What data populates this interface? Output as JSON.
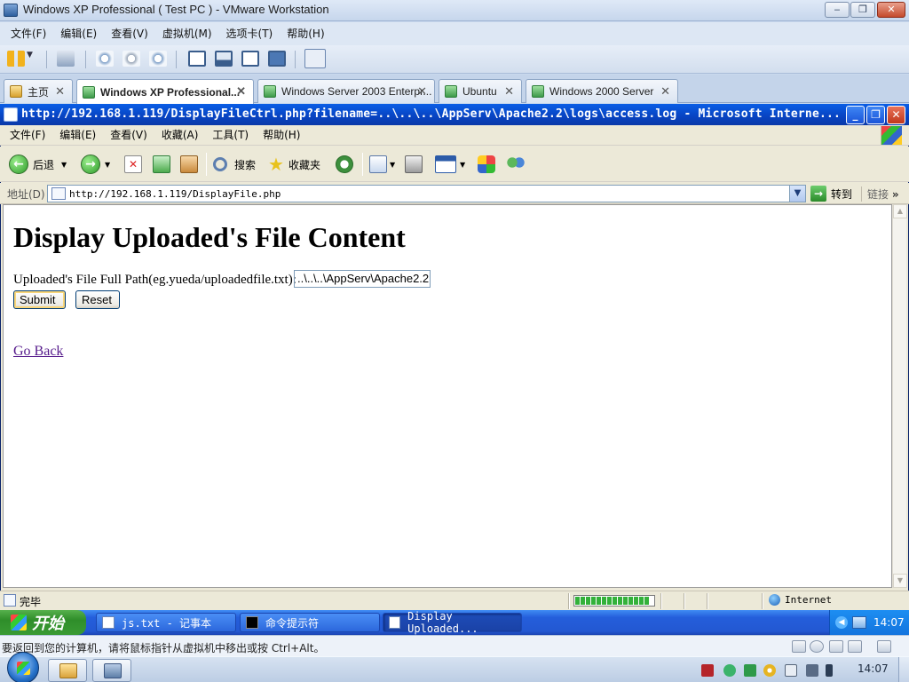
{
  "vmware": {
    "title": "Windows XP Professional ( Test PC ) - VMware Workstation",
    "caption_buttons": {
      "minimize": "‒",
      "maximize": "❐",
      "close": "✕"
    },
    "menu": [
      "文件(F)",
      "编辑(E)",
      "查看(V)",
      "虚拟机(M)",
      "选项卡(T)",
      "帮助(H)"
    ],
    "tabs": [
      {
        "label": "主页",
        "close": "✕"
      },
      {
        "label": "Windows XP Professional...",
        "close": "✕"
      },
      {
        "label": "Windows Server 2003 Enterpr...",
        "close": "✕"
      },
      {
        "label": "Ubuntu",
        "close": "✕"
      },
      {
        "label": "Windows 2000 Server",
        "close": "✕"
      }
    ],
    "hint": "要返回到您的计算机，请将鼠标指针从虚拟机中移出或按 Ctrl+Alt。"
  },
  "ie": {
    "title": "http://192.168.1.119/DisplayFileCtrl.php?filename=..\\..\\..\\AppServ\\Apache2.2\\logs\\access.log - Microsoft Interne...",
    "caption_buttons": {
      "minimize": "_",
      "maximize": "❐",
      "close": "✕"
    },
    "menu": [
      "文件(F)",
      "编辑(E)",
      "查看(V)",
      "收藏(A)",
      "工具(T)",
      "帮助(H)"
    ],
    "toolbar": {
      "back": "后退",
      "search": "搜索",
      "favorites": "收藏夹"
    },
    "address": {
      "label": "地址(D)",
      "url": "http://192.168.1.119/DisplayFile.php",
      "go": "转到",
      "links": "链接"
    },
    "status": {
      "text": "完毕",
      "zone": "Internet"
    }
  },
  "page": {
    "heading": "Display Uploaded's File Content",
    "path_label": "Uploaded's File Full Path(eg.yueda/uploadedfile.txt):",
    "path_value": "..\\..\\..\\AppServ\\Apache2.2",
    "submit": "Submit",
    "reset": "Reset",
    "go_back": "Go Back"
  },
  "xp_taskbar": {
    "start": "开始",
    "tasks": [
      "js.txt - 记事本",
      "命令提示符",
      "Display Uploaded..."
    ],
    "clock": "14:07"
  },
  "win7_taskbar": {
    "clock": "14:07"
  },
  "colors": {
    "xp_title_blue": "#0843c1",
    "xp_taskbar_blue": "#245edb",
    "visited_link": "#551a8b",
    "progress_green": "#33b13a"
  }
}
